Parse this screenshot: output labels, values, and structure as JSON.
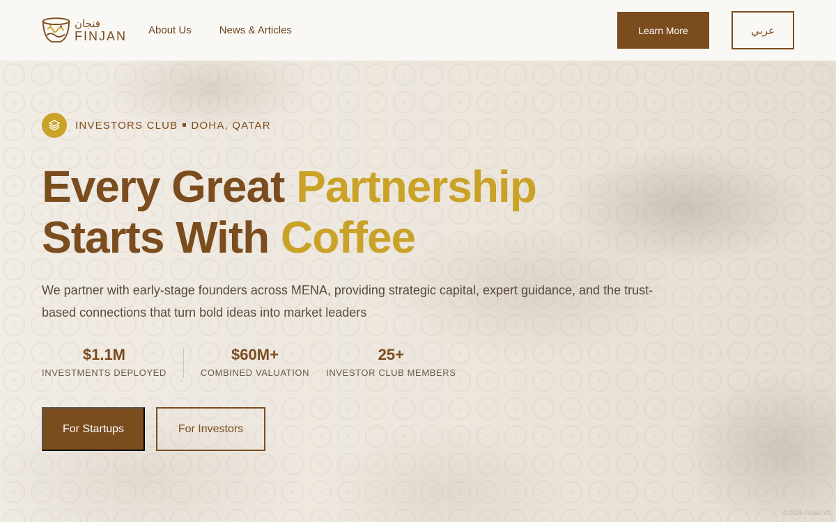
{
  "header": {
    "logo": {
      "arabic": "فنجان",
      "english": "FINJAN",
      "icon": "coffee-cup-icon"
    },
    "nav": [
      {
        "label": "About Us"
      },
      {
        "label": "News & Articles"
      }
    ],
    "learn_more_label": "Learn More",
    "language_label": "عربي"
  },
  "hero": {
    "eyebrow": {
      "icon": "layers-icon",
      "part1": "INVESTORS CLUB",
      "part2": "DOHA, QATAR"
    },
    "headline": {
      "line1_a": "Every Great ",
      "line1_b": "Partnership",
      "line2_a": "Starts With ",
      "line2_b": "Coffee"
    },
    "subtext": "We partner with early-stage founders across MENA, providing strategic capital, expert guidance, and the trust-based connections that turn bold ideas into market leaders",
    "stats": [
      {
        "value": "$1.1M",
        "label": "INVESTMENTS DEPLOYED"
      },
      {
        "value": "$60M+",
        "label": "COMBINED VALUATION"
      },
      {
        "value": "25+",
        "label": "INVESTOR CLUB MEMBERS"
      }
    ],
    "cta_startups": "For Startups",
    "cta_investors": "For Investors"
  },
  "footer": {
    "note": "© 2025 Finjan VC"
  },
  "colors": {
    "brand_brown": "#7b4c1e",
    "accent_gold": "#c9a227",
    "header_bg": "#faf8f5"
  }
}
